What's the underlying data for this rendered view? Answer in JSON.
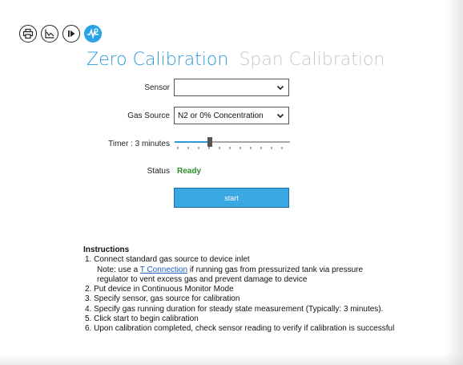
{
  "toolbar": {
    "icons": [
      "print-icon",
      "chart-icon",
      "play-icon",
      "calibration-icon"
    ]
  },
  "tabs": {
    "zero_label": "Zero Calibration",
    "span_label": "Span Calibration"
  },
  "form": {
    "sensor_label": "Sensor",
    "sensor_value": "",
    "gas_source_label": "Gas Source",
    "gas_source_value": "N2 or 0% Concentration",
    "timer_label": "Timer : 3 minutes",
    "timer_value_minutes": 3,
    "status_label": "Status",
    "status_value": "Ready",
    "start_label": "start"
  },
  "instructions": {
    "title": "Instructions",
    "step1": "1. Connect standard gas source to device inlet",
    "note_prefix": "Note: use a ",
    "note_link": "T Connection",
    "note_suffix": " if running gas from pressurized tank via pressure",
    "note_line2": "regulator to vent excess gas and prevent damage to device",
    "step2": "2. Put device in Continuous Monitor Mode",
    "step3": "3. Specify sensor, gas source for calibration",
    "step4": "4. Specify gas running duration for steady state measurement (Typically: 3 minutes).",
    "step5": "5. Click start to begin calibration",
    "step6": "6. Upon calibration completed, check sensor reading to verify if calibration is successful"
  },
  "colors": {
    "accent": "#2a9bd8",
    "status_ready": "#2e8b2e",
    "start_button": "#3aa8e2"
  }
}
